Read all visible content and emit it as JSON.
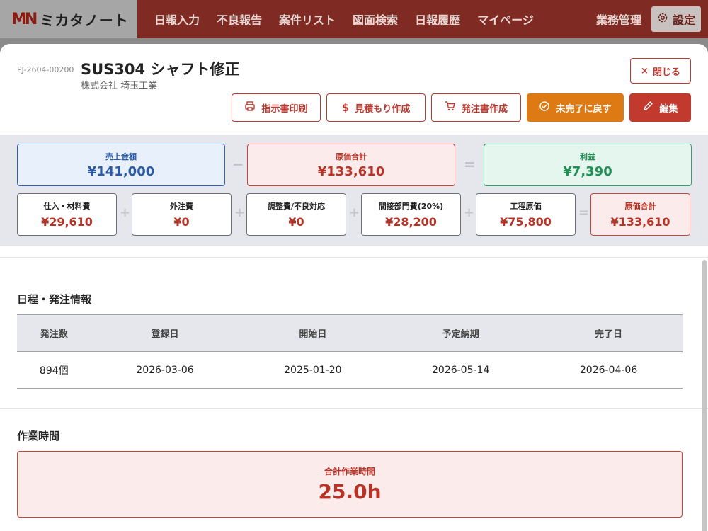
{
  "nav": {
    "logo_mark": "MN",
    "logo_text": "ミカタノート",
    "items": [
      "日報入力",
      "不良報告",
      "案件リスト",
      "図面検索",
      "日報履歴",
      "マイページ"
    ],
    "business": "業務管理",
    "settings": "設定"
  },
  "project": {
    "id": "PJ-2604-00200",
    "title": "SUS304 シャフト修正",
    "company": "株式会社 埼玉工業",
    "close_label": "閉じる"
  },
  "actions": {
    "print": "指示書印刷",
    "estimate": "見積もり作成",
    "order": "発注書作成",
    "incomplete": "未完了に戻す",
    "edit": "編集"
  },
  "costs": {
    "sales": {
      "label": "売上金額",
      "value": "¥141,000"
    },
    "cost_total": {
      "label": "原価合計",
      "value": "¥133,610"
    },
    "profit": {
      "label": "利益",
      "value": "¥7,390"
    },
    "ops": {
      "minus": "−",
      "equals": "=",
      "plus": "+"
    },
    "breakdown": [
      {
        "label": "仕入・材料費",
        "value": "¥29,610"
      },
      {
        "label": "外注費",
        "value": "¥0"
      },
      {
        "label": "調整費/不良対応",
        "value": "¥0"
      },
      {
        "label": "間接部門費(20%)",
        "value": "¥28,200"
      },
      {
        "label": "工程原価",
        "value": "¥75,800"
      },
      {
        "label": "原価合計",
        "value": "¥133,610"
      }
    ]
  },
  "schedule": {
    "title": "日程・発注情報",
    "headers": [
      "発注数",
      "登録日",
      "開始日",
      "予定納期",
      "完了日"
    ],
    "row": [
      "894個",
      "2026-03-06",
      "2025-01-20",
      "2026-05-14",
      "2026-04-06"
    ]
  },
  "work": {
    "title": "作業時間",
    "label": "合計作業時間",
    "value": "25.0h"
  },
  "colors": {
    "brand": "#7f2a22",
    "accent_red": "#c23a2e",
    "orange": "#dd7a14",
    "blue": "#2f63b3",
    "green": "#35a06c"
  }
}
